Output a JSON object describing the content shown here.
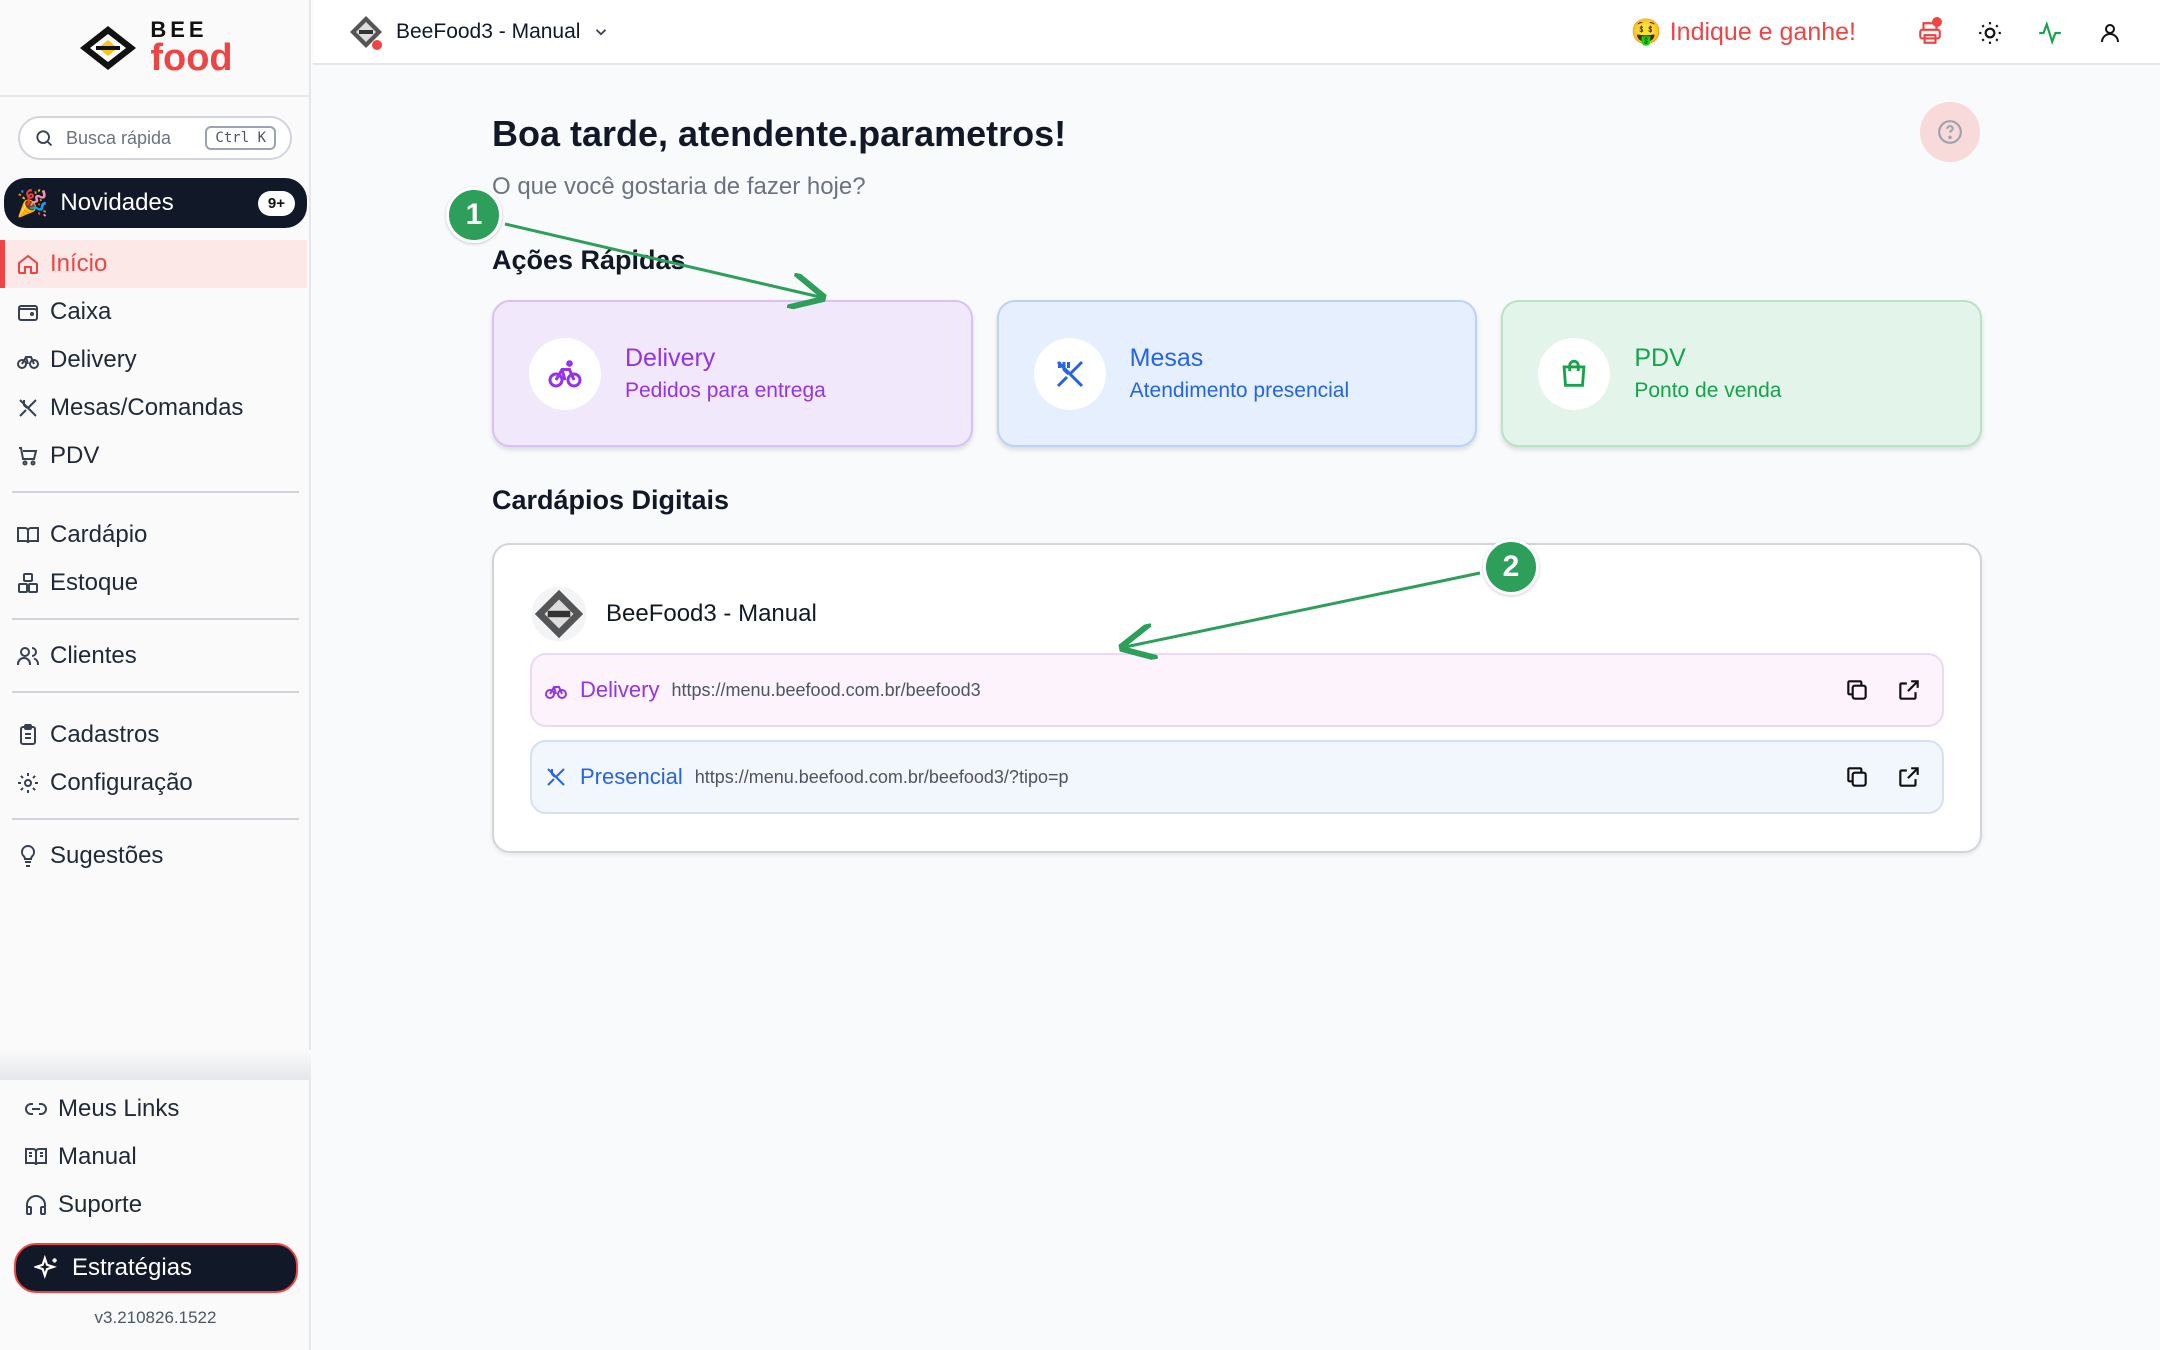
{
  "brand": {
    "line1": "BEE",
    "line2": "food"
  },
  "search": {
    "placeholder": "Busca rápida",
    "shortcut": "Ctrl K"
  },
  "news": {
    "label": "Novidades",
    "badge": "9+"
  },
  "nav": {
    "inicio": "Início",
    "caixa": "Caixa",
    "delivery": "Delivery",
    "mesas": "Mesas/Comandas",
    "pdv": "PDV",
    "cardapio": "Cardápio",
    "estoque": "Estoque",
    "clientes": "Clientes",
    "cadastros": "Cadastros",
    "configuracao": "Configuração",
    "sugestoes": "Sugestões"
  },
  "bottom_nav": {
    "links": "Meus Links",
    "manual": "Manual",
    "suporte": "Suporte"
  },
  "strategy": {
    "label": "Estratégias"
  },
  "version": "v3.210826.1522",
  "header": {
    "store": "BeeFood3 - Manual",
    "referral": "Indique e ganhe!"
  },
  "main": {
    "greeting": "Boa tarde, atendente.parametros!",
    "subgreeting": "O que você gostaria de fazer hoje?",
    "quick_title": "Ações Rápidas",
    "cards": [
      {
        "title": "Delivery",
        "desc": "Pedidos para entrega"
      },
      {
        "title": "Mesas",
        "desc": "Atendimento presencial"
      },
      {
        "title": "PDV",
        "desc": "Ponto de venda"
      }
    ],
    "menus_title": "Cardápios Digitais",
    "menus_store": "BeeFood3 - Manual",
    "links": [
      {
        "label": "Delivery",
        "url": "https://menu.beefood.com.br/beefood3"
      },
      {
        "label": "Presencial",
        "url": "https://menu.beefood.com.br/beefood3/?tipo=p"
      }
    ]
  },
  "annotations": [
    "1",
    "2"
  ],
  "colors": {
    "accent": "#ef4444",
    "delivery": "#9333ea",
    "mesas": "#2563eb",
    "pdv": "#16a34a",
    "annotation": "#2e9e5b"
  }
}
